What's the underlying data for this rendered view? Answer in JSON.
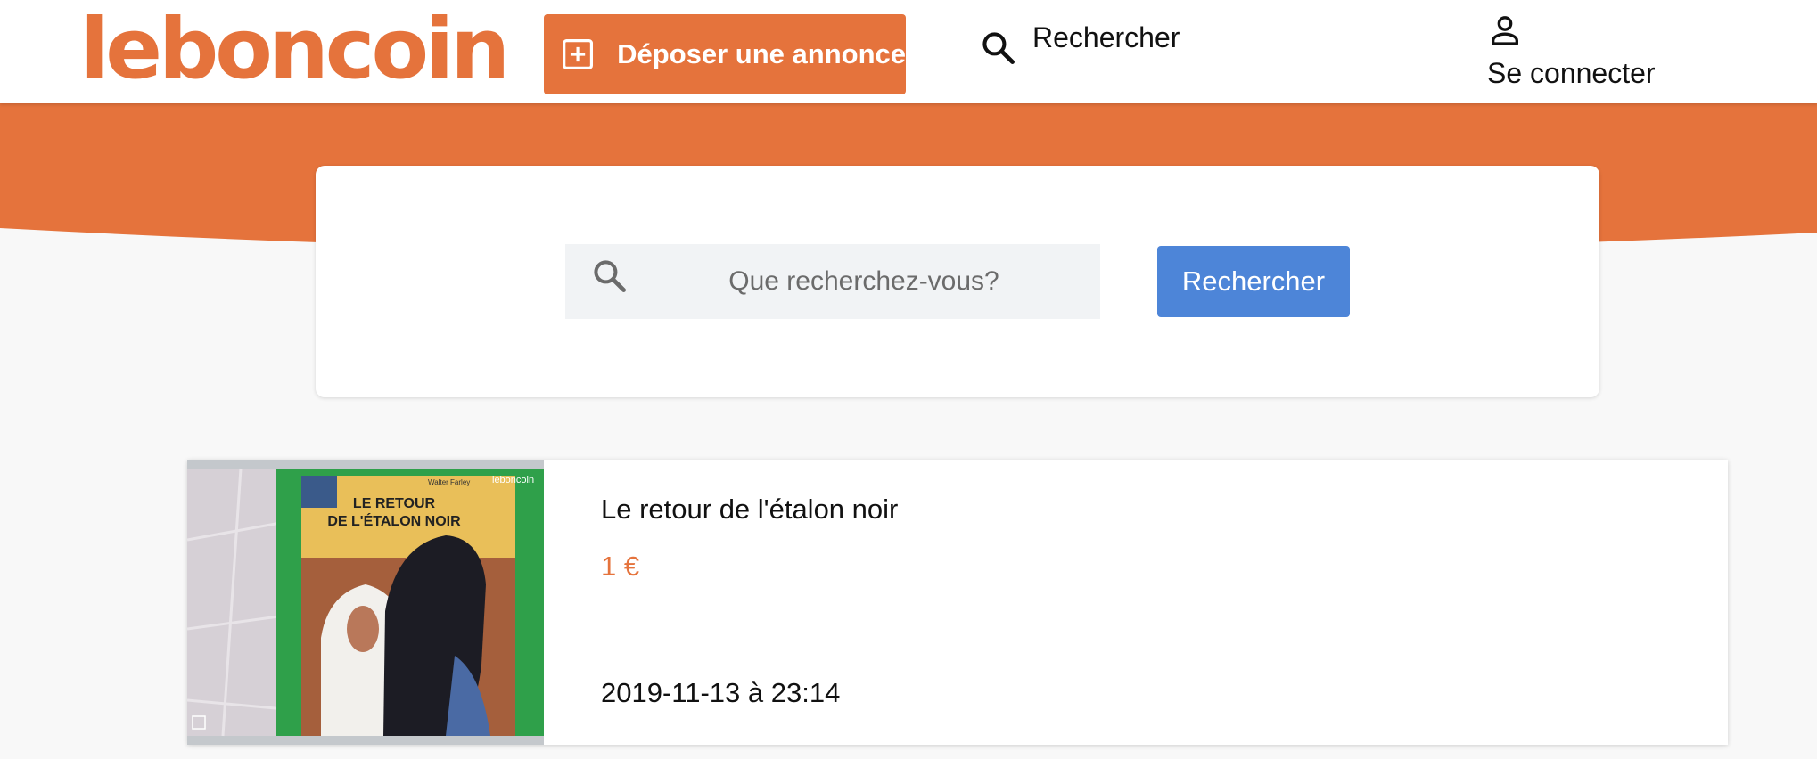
{
  "brand": {
    "logo_text": "leboncoin",
    "accent_color": "#e5733c",
    "search_button_color": "#4d85d8"
  },
  "header": {
    "post_ad_label": "Déposer une annonce",
    "post_ad_icon": "plus-square-icon",
    "search_label": "Rechercher",
    "search_icon": "search-icon",
    "login_label": "Se connecter",
    "login_icon": "user-icon"
  },
  "search": {
    "placeholder": "Que recherchez-vous?",
    "value": "",
    "button_label": "Rechercher"
  },
  "listings": [
    {
      "title": "Le retour de l'étalon noir",
      "price": "1 €",
      "date": "2019-11-13 à 23:14",
      "thumbnail": {
        "book_title_line1": "LE RETOUR",
        "book_title_line2": "DE L'ÉTALON NOIR",
        "author": "Walter Farley",
        "watermark": "leboncoin"
      }
    }
  ]
}
